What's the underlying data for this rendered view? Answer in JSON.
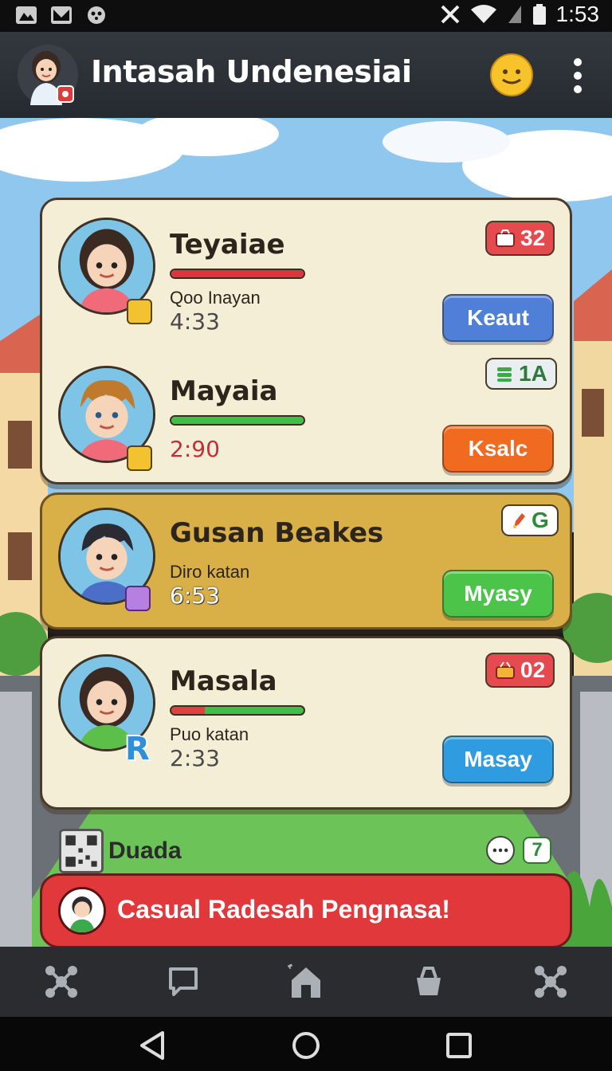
{
  "status_bar": {
    "time": "1:53"
  },
  "app_bar": {
    "title": "Intasah Undenesiai"
  },
  "players": [
    {
      "name": "Teyaiae",
      "subtitle": "Qoo Inayan",
      "time": "4:33",
      "bar_fill_percent": 100,
      "bar_color": "#d9363e",
      "badge": "32",
      "badge_color": "#e54a4f",
      "button": "Keaut",
      "button_color": "#4f7fd6"
    },
    {
      "name": "Mayaia",
      "subtitle": "",
      "time": "2:90",
      "bar_fill_percent": 100,
      "bar_color": "#3fbf4a",
      "badge": "1A",
      "badge_color": "#e9eef0",
      "button": "Ksalc",
      "button_color": "#f06a1f"
    },
    {
      "name": "Gusan Beakes",
      "subtitle": "Diro katan",
      "time": "6:53",
      "badge": "G",
      "badge_color": "#ffffff",
      "button": "Myasy",
      "button_color": "#4cc44a"
    },
    {
      "name": "Masala",
      "subtitle": "Puo katan",
      "time": "2:33",
      "bar_fill_percent": 25,
      "bar_color": "#3fbf4a",
      "badge": "02",
      "badge_color": "#e54a4f",
      "button": "Masay",
      "button_color": "#2f9be0"
    }
  ],
  "strip": {
    "label": "Duada",
    "count": "7"
  },
  "banner": {
    "text": "Casual Radesah Pengnasa!"
  }
}
